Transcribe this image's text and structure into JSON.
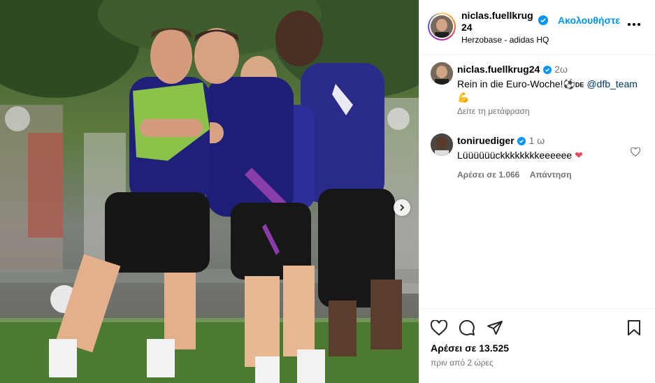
{
  "header": {
    "username": "niclas.fuellkrug24",
    "follow_label": "Ακολουθήστε",
    "location": "Herzobase - adidas HQ"
  },
  "comments": [
    {
      "username": "niclas.fuellkrug24",
      "time": "2ω",
      "text_before": "Rein in die Euro-Woche!",
      "emoji": "⚽",
      "flag": "DE",
      "mention": "@dfb_team",
      "emoji2": "💪",
      "translate_label": "Δείτε τη μετάφραση"
    },
    {
      "username": "toniruediger",
      "time": "1 ω",
      "text": "Lüüüüüückkkkkkkkeeeeee",
      "heart": "❤",
      "likes_label": "Αρέσει σε 1.066",
      "reply_label": "Απάντηση"
    }
  ],
  "footer": {
    "likes": "Αρέσει σε 13.525",
    "posted": "πριν από 2 ώρες"
  },
  "colors": {
    "accent": "#0095f6",
    "verified": "#0095f6",
    "heart": "#ed4956"
  },
  "icons": [
    "verified-badge-icon",
    "more-options-icon",
    "heart-icon",
    "comment-icon",
    "share-icon",
    "bookmark-icon",
    "next-arrow-icon"
  ]
}
